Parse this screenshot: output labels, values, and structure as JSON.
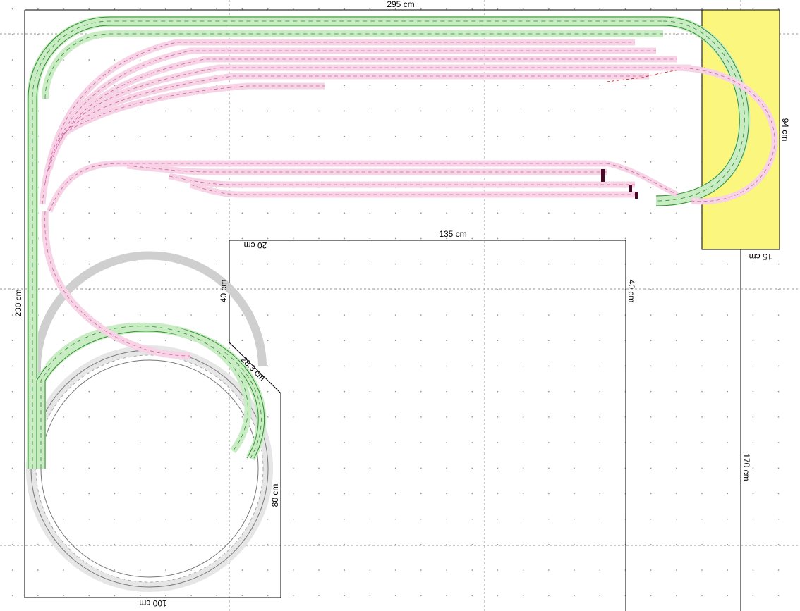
{
  "dimensions": {
    "top_width": "295 cm",
    "left_height": "230 cm",
    "yellow_height": "94 cm",
    "yellow_width": "15 cm",
    "right_height": "170 cm",
    "inner_width": "135 cm",
    "inner_notch": "20 cm",
    "inner_left_height": "40 cm",
    "inner_right_height": "40 cm",
    "diagonal": "28.3 cm",
    "lower_right_height": "80 cm",
    "bottom_width": "100 cm"
  },
  "colors": {
    "outline": "#000000",
    "grid_dot": "#777777",
    "grid_line": "#9a9a9a",
    "yellow_area": "#fbf67e",
    "green_track": "#2c8f2c",
    "green_fill": "#c9ecc4",
    "pink_track": "#d45fa0",
    "pink_fill": "#f6d4e6",
    "gray_track": "#777777",
    "red_accent": "#cc1111"
  }
}
